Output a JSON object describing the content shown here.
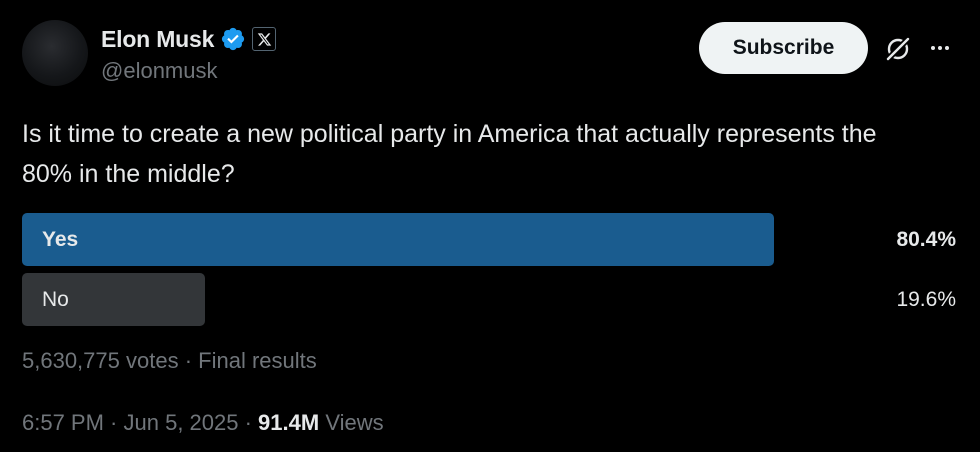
{
  "author": {
    "display_name": "Elon Musk",
    "handle": "@elonmusk",
    "verified_color": "#1d9bf0"
  },
  "header": {
    "subscribe_label": "Subscribe",
    "grok_icon": "grok-icon",
    "more_icon": "more-horizontal-icon"
  },
  "tweet": {
    "text": "Is it time to create a new political party in America that actually represents the 80% in the middle?"
  },
  "poll": {
    "options": [
      {
        "label": "Yes",
        "percent_text": "80.4%",
        "share": 0.804,
        "winner": true,
        "color": "#1a5c8f"
      },
      {
        "label": "No",
        "percent_text": "19.6%",
        "share": 0.196,
        "winner": false,
        "color": "#333639"
      }
    ],
    "votes": "5,630,775 votes",
    "separator": " · ",
    "status": "Final results"
  },
  "meta": {
    "time": "6:57 PM",
    "separator": " · ",
    "date": "Jun 5, 2025",
    "views_count": "91.4M",
    "views_label": "Views"
  }
}
